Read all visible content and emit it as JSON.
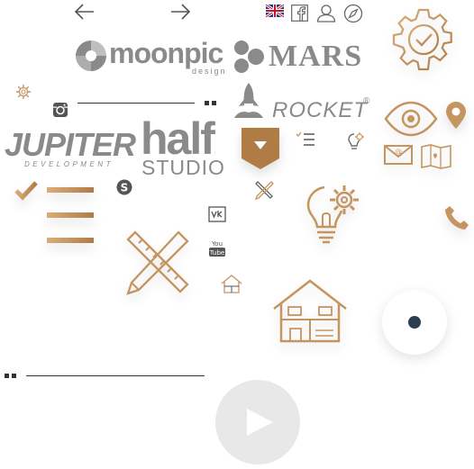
{
  "colors": {
    "accent": "#c4955f",
    "accent_dark": "#b07c45",
    "logo_gray": "#8a8a8a",
    "dark_dot": "#2c3e50",
    "play_bg": "#e8e8e8"
  },
  "nav": {
    "prev_icon": "arrow-left-icon",
    "next_icon": "arrow-right-icon"
  },
  "top_icons": [
    "uk-flag-icon",
    "facebook-icon",
    "user-icon",
    "compass-icon"
  ],
  "logos": {
    "moonpic": {
      "name": "moonpic",
      "sub": "design"
    },
    "mars": {
      "name": "MARS"
    },
    "rocket": {
      "name": "ROCKET",
      "mark": "®"
    },
    "jupiter": {
      "name": "JUPITER",
      "sub": "DEVELOPMENT"
    },
    "half": {
      "name": "half",
      "sub": "STUDIO"
    }
  }
}
